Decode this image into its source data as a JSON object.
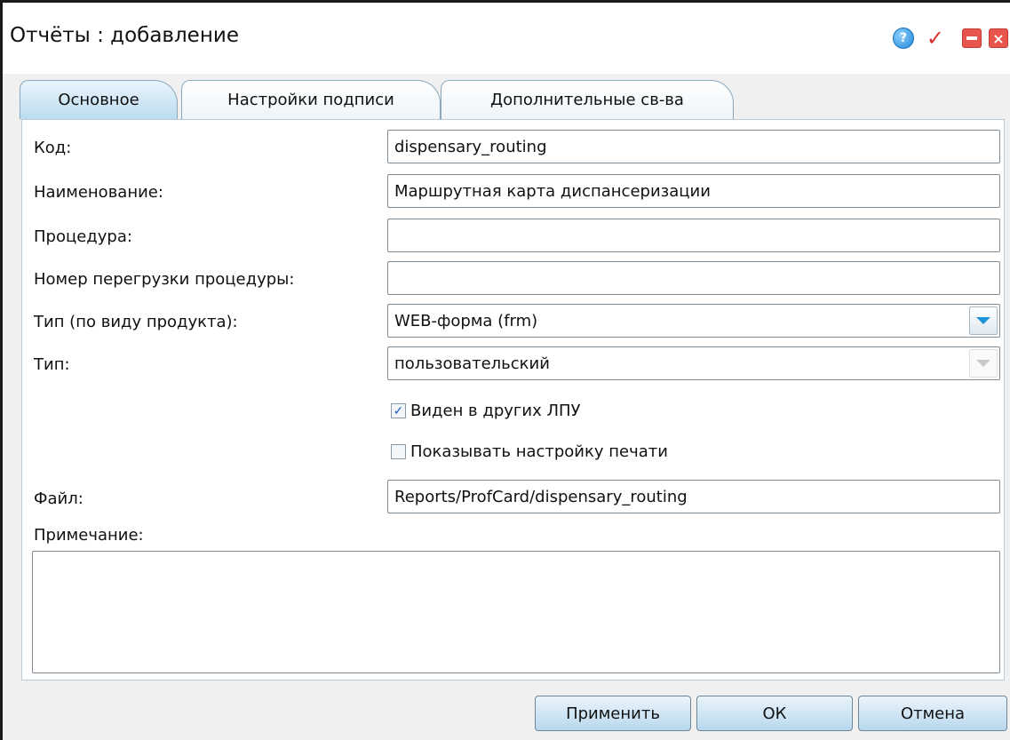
{
  "window": {
    "title": "Отчёты : добавление"
  },
  "title_icons": {
    "help": "?",
    "confirm": "✓",
    "close": "×"
  },
  "tabs": [
    {
      "label": "Основное",
      "active": true
    },
    {
      "label": "Настройки подписи",
      "active": false
    },
    {
      "label": "Дополнительные св-ва",
      "active": false
    }
  ],
  "form": {
    "code": {
      "label": "Код:",
      "value": "dispensary_routing"
    },
    "name": {
      "label": "Наименование:",
      "value": "Маршрутная карта диспансеризации"
    },
    "procedure": {
      "label": "Процедура:",
      "value": ""
    },
    "overload": {
      "label": "Номер перегрузки процедуры:",
      "value": ""
    },
    "product_type": {
      "label": "Тип (по виду продукта):",
      "value": "WEB-форма (frm)"
    },
    "type": {
      "label": "Тип:",
      "value": "пользовательский"
    },
    "visible_other": {
      "label": "Виден в других ЛПУ",
      "checked": true,
      "mark": "✓"
    },
    "show_print": {
      "label": "Показывать настройку печати",
      "checked": false
    },
    "file": {
      "label": "Файл:",
      "value": "Reports/ProfCard/dispensary_routing"
    },
    "notes": {
      "label": "Примечание:",
      "value": ""
    }
  },
  "buttons": {
    "apply": "Применить",
    "ok": "ОК",
    "cancel": "Отмена"
  },
  "colors": {
    "tab_active": "#bcdcf0",
    "button": "#b8d8ee",
    "combo_arrow": "#1d95d8",
    "title_buttons": "#e8554c"
  }
}
